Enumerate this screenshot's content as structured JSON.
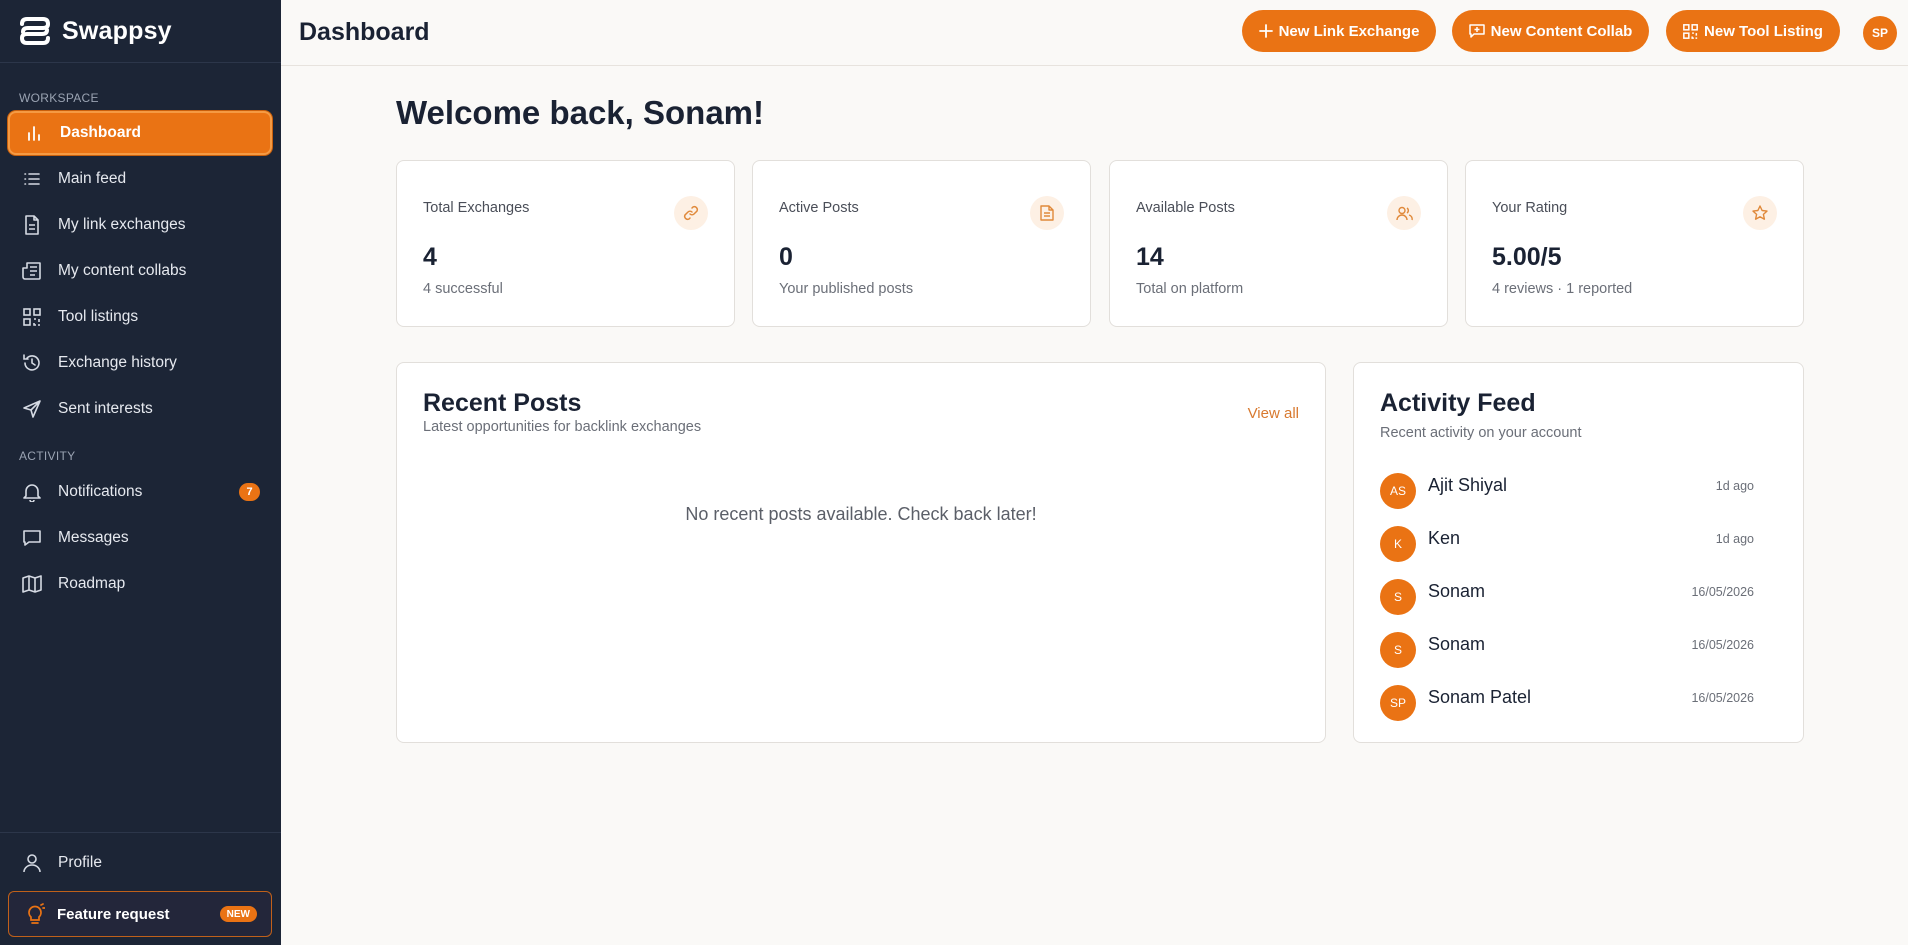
{
  "app": {
    "name": "Swappsy"
  },
  "sidebar": {
    "workspace_label": "WORKSPACE",
    "activity_label": "ACTIVITY",
    "workspace_items": [
      {
        "label": "Dashboard",
        "icon": "bar-chart-icon"
      },
      {
        "label": "Main feed",
        "icon": "list-icon"
      },
      {
        "label": "My link exchanges",
        "icon": "document-icon"
      },
      {
        "label": "My content collabs",
        "icon": "newspaper-icon"
      },
      {
        "label": "Tool listings",
        "icon": "grid-icon"
      },
      {
        "label": "Exchange history",
        "icon": "history-icon"
      },
      {
        "label": "Sent interests",
        "icon": "send-icon"
      }
    ],
    "activity_items": [
      {
        "label": "Notifications",
        "icon": "bell-icon",
        "badge": "7"
      },
      {
        "label": "Messages",
        "icon": "message-icon"
      },
      {
        "label": "Roadmap",
        "icon": "map-icon"
      }
    ],
    "profile_label": "Profile",
    "feature_request_label": "Feature request",
    "feature_request_badge": "NEW"
  },
  "header": {
    "title": "Dashboard",
    "buttons": [
      {
        "label": "New Link Exchange",
        "icon": "plus-icon"
      },
      {
        "label": "New Content Collab",
        "icon": "message-plus-icon"
      },
      {
        "label": "New Tool Listing",
        "icon": "grid-icon"
      }
    ],
    "avatar_initials": "SP"
  },
  "main": {
    "welcome": "Welcome back, Sonam!",
    "stats": [
      {
        "title": "Total Exchanges",
        "value": "4",
        "sub": "4 successful",
        "icon": "link-icon"
      },
      {
        "title": "Active Posts",
        "value": "0",
        "sub": "Your published posts",
        "icon": "file-icon"
      },
      {
        "title": "Available Posts",
        "value": "14",
        "sub": "Total on platform",
        "icon": "users-icon"
      },
      {
        "title": "Your Rating",
        "value": "5.00/5",
        "sub": "4 reviews · 1 reported",
        "icon": "star-icon"
      }
    ],
    "recent_posts": {
      "title": "Recent Posts",
      "subtitle": "Latest opportunities for backlink exchanges",
      "view_all": "View all",
      "empty_message": "No recent posts available. Check back later!"
    },
    "activity_feed": {
      "title": "Activity Feed",
      "subtitle": "Recent activity on your account",
      "items": [
        {
          "initials": "AS",
          "name": "Ajit Shiyal",
          "time": "1d ago"
        },
        {
          "initials": "K",
          "name": "Ken",
          "time": "1d ago"
        },
        {
          "initials": "S",
          "name": "Sonam",
          "time": "16/05/2026"
        },
        {
          "initials": "S",
          "name": "Sonam",
          "time": "16/05/2026"
        },
        {
          "initials": "SP",
          "name": "Sonam Patel",
          "time": "16/05/2026"
        }
      ]
    }
  },
  "colors": {
    "accent": "#ea7314",
    "sidebar_bg": "#1c2536",
    "page_bg": "#faf9f7"
  }
}
